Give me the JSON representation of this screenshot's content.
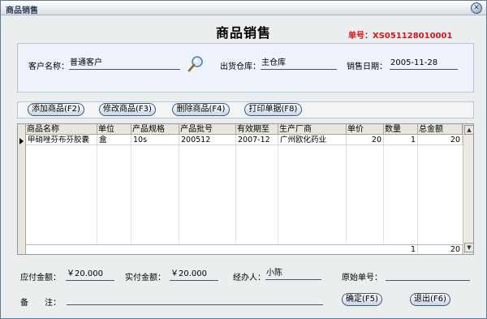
{
  "window": {
    "title": "商品销售",
    "close_glyph": "✕"
  },
  "form": {
    "heading": "商品销售",
    "order_no": "单号：XS051128010001"
  },
  "info": {
    "customer_label": "客户名称：",
    "customer_value": "普通客户",
    "warehouse_label": "出货仓库：",
    "warehouse_value": "主仓库",
    "date_label": "销售日期：",
    "date_value": "2005-11-28"
  },
  "toolbar": {
    "add": "添加商品(F2)",
    "edit": "修改商品(F3)",
    "delete": "删除商品(F4)",
    "print": "打印单据(F8)"
  },
  "table": {
    "columns": [
      "商品名称",
      "单位",
      "产品规格",
      "产品批号",
      "有效期至",
      "生产厂商",
      "单价",
      "数量",
      "总金额"
    ],
    "rows": [
      [
        "甲硝唑芬布芬胶囊",
        "盒",
        "10s",
        "200512",
        "2007-12",
        "广州欧化药业",
        "20",
        "1",
        "20"
      ]
    ],
    "totals": {
      "quantity": "1",
      "amount": "20"
    }
  },
  "footer": {
    "payable_label": "应付金额：",
    "payable_value": "￥20.000",
    "paid_label": "实付金额：",
    "paid_value": "￥20.000",
    "handler_label": "经办人：",
    "handler_value": "小陈",
    "orig_label": "原始单号：",
    "orig_value": "",
    "remark_label": "备　　注：",
    "remark_value": "",
    "confirm": "确定(F5)",
    "exit": "退出(F6)"
  },
  "icons": {
    "search": "search-icon"
  },
  "colors": {
    "order_no": "#d9141a",
    "panel": "#edf2fb",
    "button_border": "#3c5a7d"
  }
}
